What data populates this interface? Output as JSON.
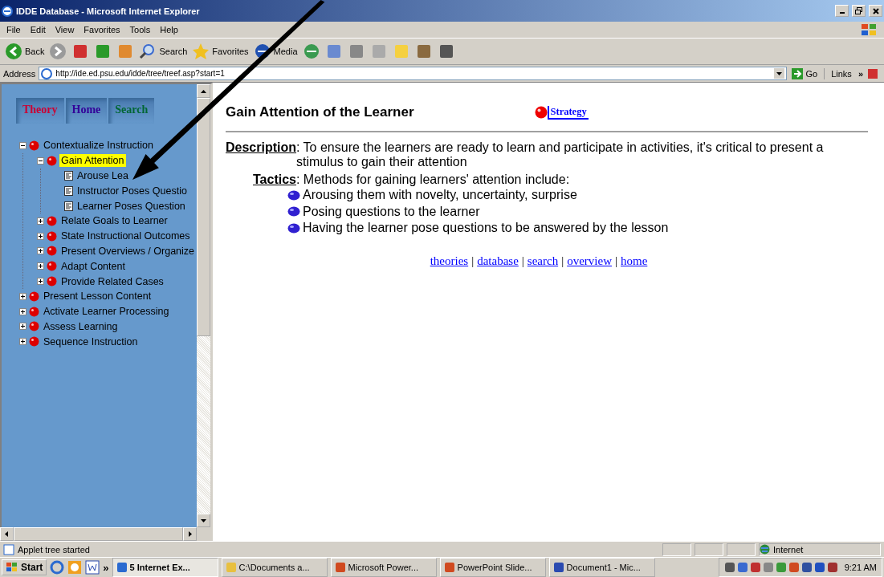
{
  "window": {
    "title": "IDDE Database - Microsoft Internet Explorer"
  },
  "menu": [
    "File",
    "Edit",
    "View",
    "Favorites",
    "Tools",
    "Help"
  ],
  "toolbar": [
    {
      "kind": "back",
      "label": "Back"
    },
    {
      "kind": "forward"
    },
    {
      "kind": "stop"
    },
    {
      "kind": "refresh"
    },
    {
      "kind": "home"
    },
    {
      "kind": "search",
      "label": "Search"
    },
    {
      "kind": "favorites",
      "label": "Favorites"
    },
    {
      "kind": "media",
      "label": "Media"
    },
    {
      "kind": "history"
    },
    {
      "kind": "mail"
    },
    {
      "kind": "print"
    },
    {
      "kind": "edit"
    },
    {
      "kind": "note"
    },
    {
      "kind": "research"
    },
    {
      "kind": "window"
    }
  ],
  "address": {
    "label": "Address",
    "value": "http://ide.ed.psu.edu/idde/tree/treef.asp?start=1",
    "go": "Go",
    "links": "Links",
    "more": "»"
  },
  "nav_tabs": [
    {
      "label": "Theory",
      "color": "#cc0033"
    },
    {
      "label": "Home",
      "color": "#330099"
    },
    {
      "label": "Search",
      "color": "#006633"
    }
  ],
  "tree": [
    {
      "kind": "folder",
      "label": "Contextualize Instruction",
      "expanded": true,
      "selected": false,
      "children": [
        {
          "kind": "folder",
          "label": "Gain Attention",
          "expanded": true,
          "selected": true,
          "children": [
            {
              "kind": "page",
              "label": "Arouse Lea",
              "selected": false
            },
            {
              "kind": "page",
              "label": "Instructor Poses Questio",
              "selected": false
            },
            {
              "kind": "page",
              "label": "Learner Poses Question",
              "selected": false
            }
          ]
        },
        {
          "kind": "folder",
          "label": "Relate Goals to Learner",
          "expanded": false,
          "selected": false
        },
        {
          "kind": "folder",
          "label": "State Instructional Outcomes",
          "expanded": false,
          "selected": false
        },
        {
          "kind": "folder",
          "label": "Present Overviews / Organize",
          "expanded": false,
          "selected": false
        },
        {
          "kind": "folder",
          "label": "Adapt Content",
          "expanded": false,
          "selected": false
        },
        {
          "kind": "folder",
          "label": "Provide Related Cases",
          "expanded": false,
          "selected": false
        }
      ]
    },
    {
      "kind": "folder",
      "label": "Present Lesson Content",
      "expanded": false,
      "selected": false
    },
    {
      "kind": "folder",
      "label": "Activate Learner Processing",
      "expanded": false,
      "selected": false
    },
    {
      "kind": "folder",
      "label": "Assess Learning",
      "expanded": false,
      "selected": false
    },
    {
      "kind": "folder",
      "label": "Sequence Instruction",
      "expanded": false,
      "selected": false
    }
  ],
  "content": {
    "heading": "Gain Attention of the Learner",
    "strategy_link": "Strategy",
    "description_label": "Description",
    "description": ": To ensure the learners are ready to learn and participate in activities, it's critical to present a stimulus to gain their attention",
    "tactics_label": "Tactics",
    "tactics_intro": ": Methods for gaining learners' attention include:",
    "tactics": [
      "Arousing them with novelty, uncertainty, surprise",
      "Posing questions to the learner",
      "Having the learner pose questions to be answered by the lesson"
    ],
    "footer_links": [
      "theories",
      "database",
      "search",
      "overview",
      "home"
    ],
    "separator": "|"
  },
  "status_bar": {
    "text": "Applet tree started",
    "zone": "Internet"
  },
  "taskbar": {
    "start": "Start",
    "chevron": "»",
    "tasks": [
      {
        "label": "5 Internet Ex...",
        "kind": "ie",
        "selected": true
      },
      {
        "label": "C:\\Documents a...",
        "kind": "folder",
        "selected": false
      },
      {
        "label": "Microsoft Power...",
        "kind": "ppt",
        "selected": false
      },
      {
        "label": "PowerPoint Slide...",
        "kind": "ppt",
        "selected": false
      },
      {
        "label": "Document1 - Mic...",
        "kind": "word",
        "selected": false
      }
    ],
    "clock": "9:21 AM"
  }
}
